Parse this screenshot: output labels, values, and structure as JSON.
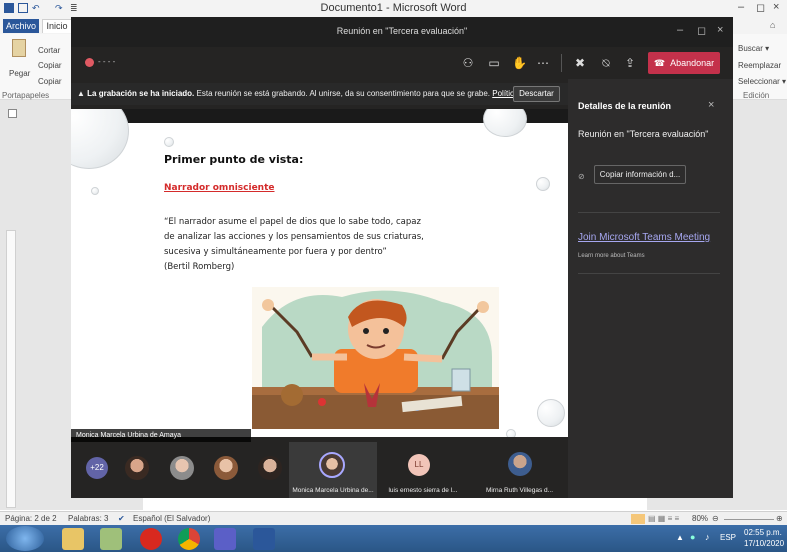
{
  "word": {
    "title": "Documento1 - Microsoft Word",
    "tabs": [
      "Archivo",
      "Inicio"
    ],
    "ribbon": {
      "cortar": "Cortar",
      "copiar": "Copiar",
      "pegar": "Pegar",
      "copiar2": "Copiar",
      "portapapeles": "Portapapeles",
      "buscar": "Buscar ▾",
      "reemplazar": "Reemplazar",
      "seleccionar": "Seleccionar ▾",
      "edicion": "Edición"
    },
    "status": {
      "page": "Página: 2 de 2",
      "words": "Palabras: 3",
      "language": "Español (El Salvador)",
      "zoom": "80%"
    }
  },
  "teams": {
    "title": "Reunión en \"Tercera evaluación\"",
    "leave_label": "Abandonar",
    "recording_notice_bold": "La grabación se ha iniciado.",
    "recording_notice_text": " Esta reunión se está grabando. Al unirse, da su consentimiento para que se grabe. ",
    "recording_notice_link": "Política de priv...",
    "dismiss_label": "Descartar",
    "details": {
      "title": "Detalles de la reunión",
      "meeting_name": "Reunión en \"Tercera evaluación\"",
      "copy_label": "Copiar información d...",
      "join_link": "Join Microsoft Teams Meeting",
      "learn_more": "Learn more about Teams"
    },
    "speaker_name": "Monica Marcela Urbina de Amaya",
    "participants": {
      "more_count": "+22",
      "active_name": "Monica Marcela Urbina de...",
      "ll_initials": "LL",
      "ll_name": "luis ernesto sierra de l...",
      "third_name": "Mirna Ruth Villegas d..."
    }
  },
  "slide": {
    "heading": "Primer punto de vista:",
    "subheading": "Narrador omnisciente",
    "quote": [
      "“El narrador asume el papel de dios que lo sabe todo, capaz",
      "de analizar las acciones y los pensamientos de sus criaturas,",
      "sucesiva y simultáneamente por fuera y por dentro”",
      "(Bertil Romberg)"
    ]
  },
  "taskbar": {
    "language": "ESP",
    "time": "02:55 p.m.",
    "date": "17/10/2020"
  },
  "colors": {
    "teams_bg": "#252423",
    "leave_red": "#c4314b",
    "accent_purple": "#6264a7",
    "link_purple": "#a6a7f0",
    "slide_red": "#d42b2b",
    "word_blue": "#2b579a"
  }
}
